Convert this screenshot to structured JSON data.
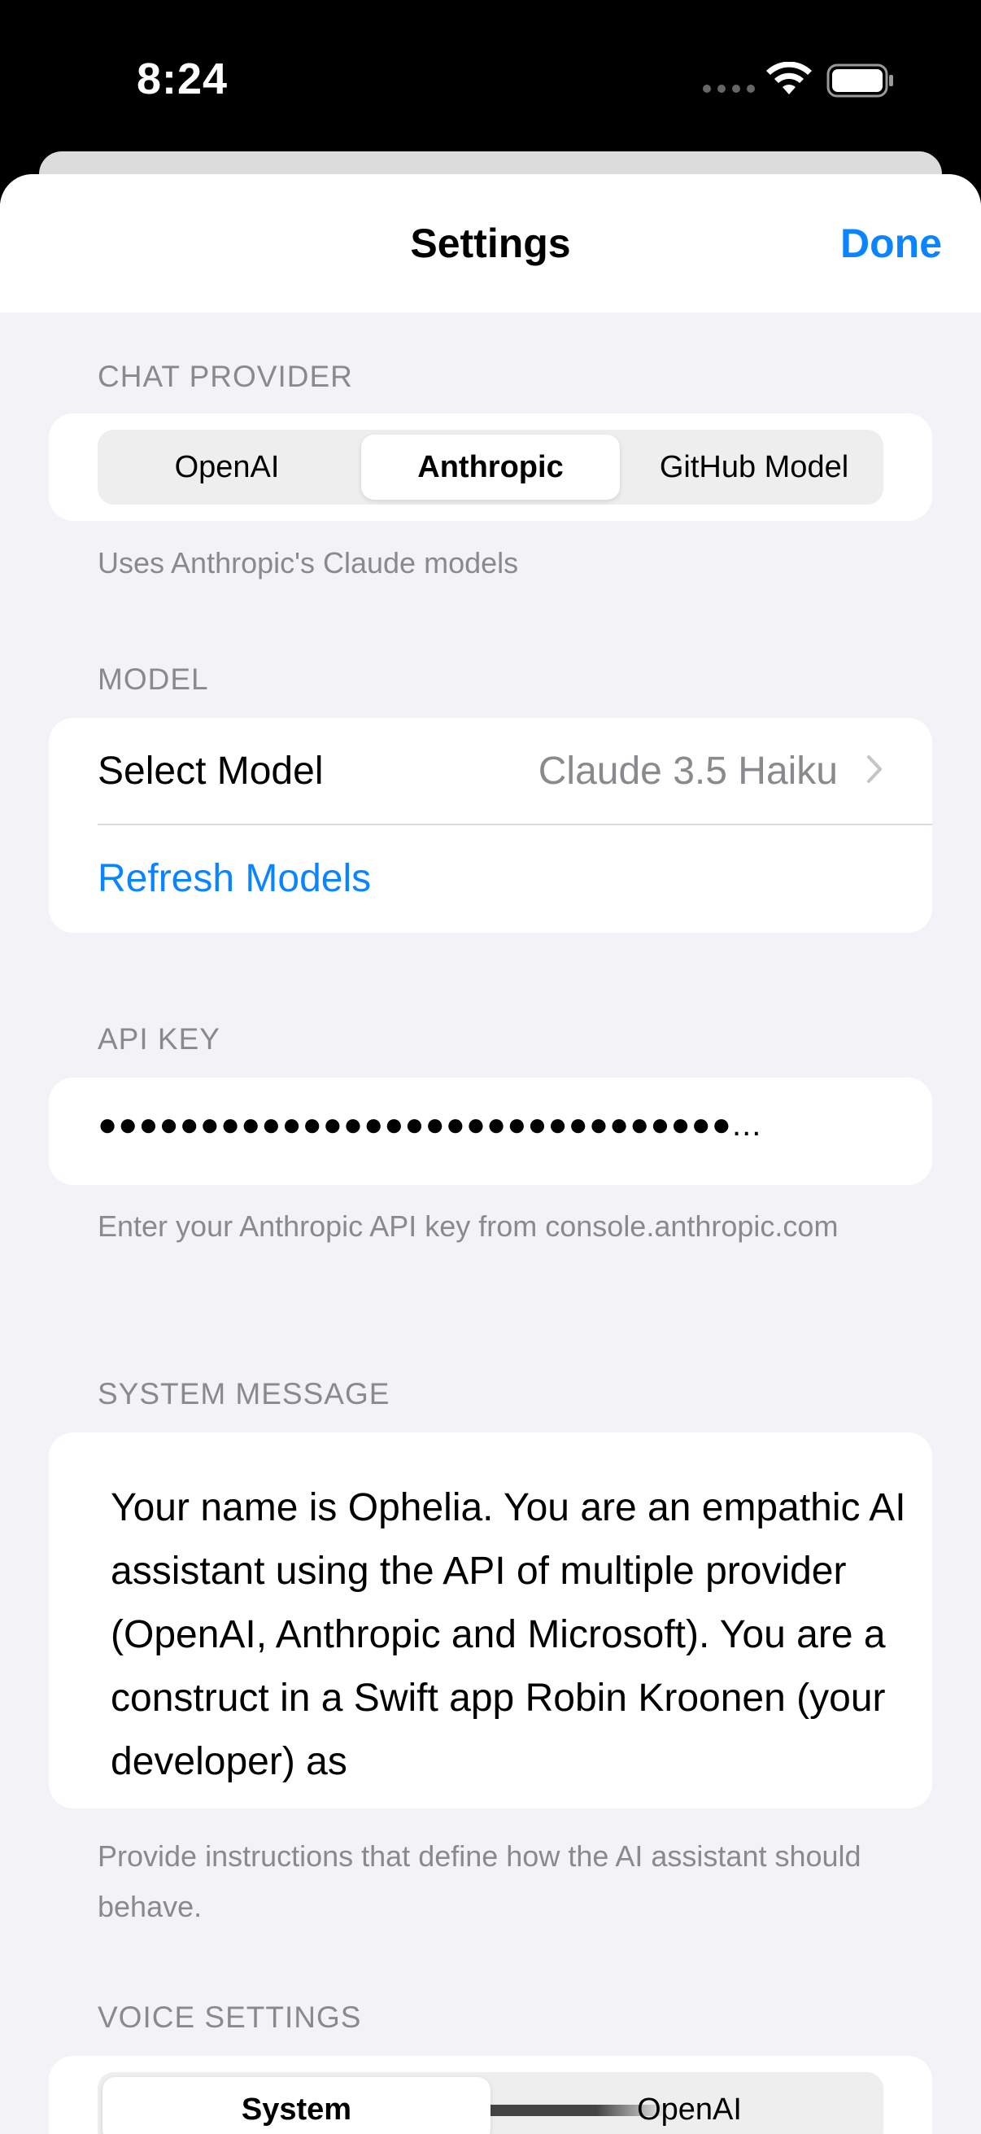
{
  "status_bar": {
    "time": "8:24",
    "wifi_icon": "wifi-icon",
    "battery_icon": "battery-icon"
  },
  "nav": {
    "title": "Settings",
    "done_label": "Done"
  },
  "chat_provider": {
    "header": "CHAT PROVIDER",
    "options": [
      "OpenAI",
      "Anthropic",
      "GitHub Model"
    ],
    "selected": "Anthropic",
    "footer": "Uses Anthropic's Claude models"
  },
  "model": {
    "header": "MODEL",
    "select_label": "Select Model",
    "selected_value": "Claude 3.5 Haiku",
    "refresh_label": "Refresh Models"
  },
  "api_key": {
    "header": "API KEY",
    "masked_value": "●●●●●●●●●●●●●●●●●●●●●●●●●●●●●●●...",
    "footer": "Enter your Anthropic API key from console.anthropic.com"
  },
  "system_message": {
    "header": "SYSTEM MESSAGE",
    "value": "Your name is Ophelia. You are an empathic AI assistant using the API of multiple provider (OpenAI, Anthropic and Microsoft). You are a construct in a Swift app Robin Kroonen (your developer) as",
    "footer": "Provide instructions that define how the AI assistant should behave."
  },
  "voice_settings": {
    "header": "VOICE SETTINGS",
    "options": [
      "System",
      "OpenAI"
    ],
    "selected": "System"
  },
  "colors": {
    "accent": "#0a84ff",
    "background": "#f2f2f7",
    "secondary_text": "#8a8a8e"
  }
}
